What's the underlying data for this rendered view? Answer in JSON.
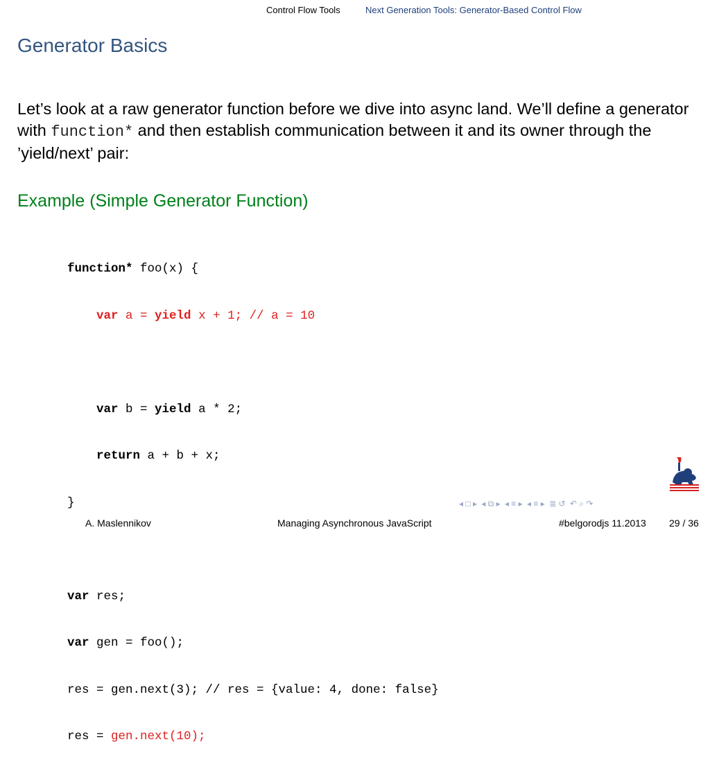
{
  "nav": {
    "section_current": "Control Flow Tools",
    "section_next": "Next Generation Tools: Generator-Based Control Flow"
  },
  "slide": {
    "title": "Generator Basics",
    "body_pre": "Let’s look at a raw generator function before we dive into async land. We’ll define a generator with ",
    "body_code": "function*",
    "body_post": " and then establish communication between it and its owner through the ’yield/next’ pair:",
    "example_title": "Example (Simple Generator Function)"
  },
  "code": {
    "l1_kw": "function*",
    "l1_rest": " foo(x) {",
    "l2_kw": "var",
    "l2_a": " a = ",
    "l2_kw2": "yield",
    "l2_b": " x + 1; ",
    "l2_comment": "// a = 10",
    "l4_kw": "var",
    "l4_a": " b = ",
    "l4_kw2": "yield",
    "l4_b": " a * 2;",
    "l5_kw": "return",
    "l5_rest": " a + b + x;",
    "l6": "}",
    "l8_kw": "var",
    "l8_rest": " res;",
    "l9_kw": "var",
    "l9_rest": " gen = foo();",
    "l10": "res = gen.next(3); // res = {value: 4, done: false}",
    "l11_a": "res = ",
    "l11_red": "gen.next(10);"
  },
  "footer": {
    "author": "A. Maslennikov",
    "title": "Managing Asynchronous JavaScript",
    "event": "#belgorodjs 11.2013",
    "page": "29 / 36"
  },
  "colors": {
    "title": "#33557f",
    "example": "#00801a",
    "highlight": "#e02020"
  },
  "icons": [
    "nav-first-icon",
    "nav-frame-icon",
    "nav-subsection-icon",
    "nav-section-icon",
    "nav-search-icon",
    "nav-back-icon"
  ]
}
